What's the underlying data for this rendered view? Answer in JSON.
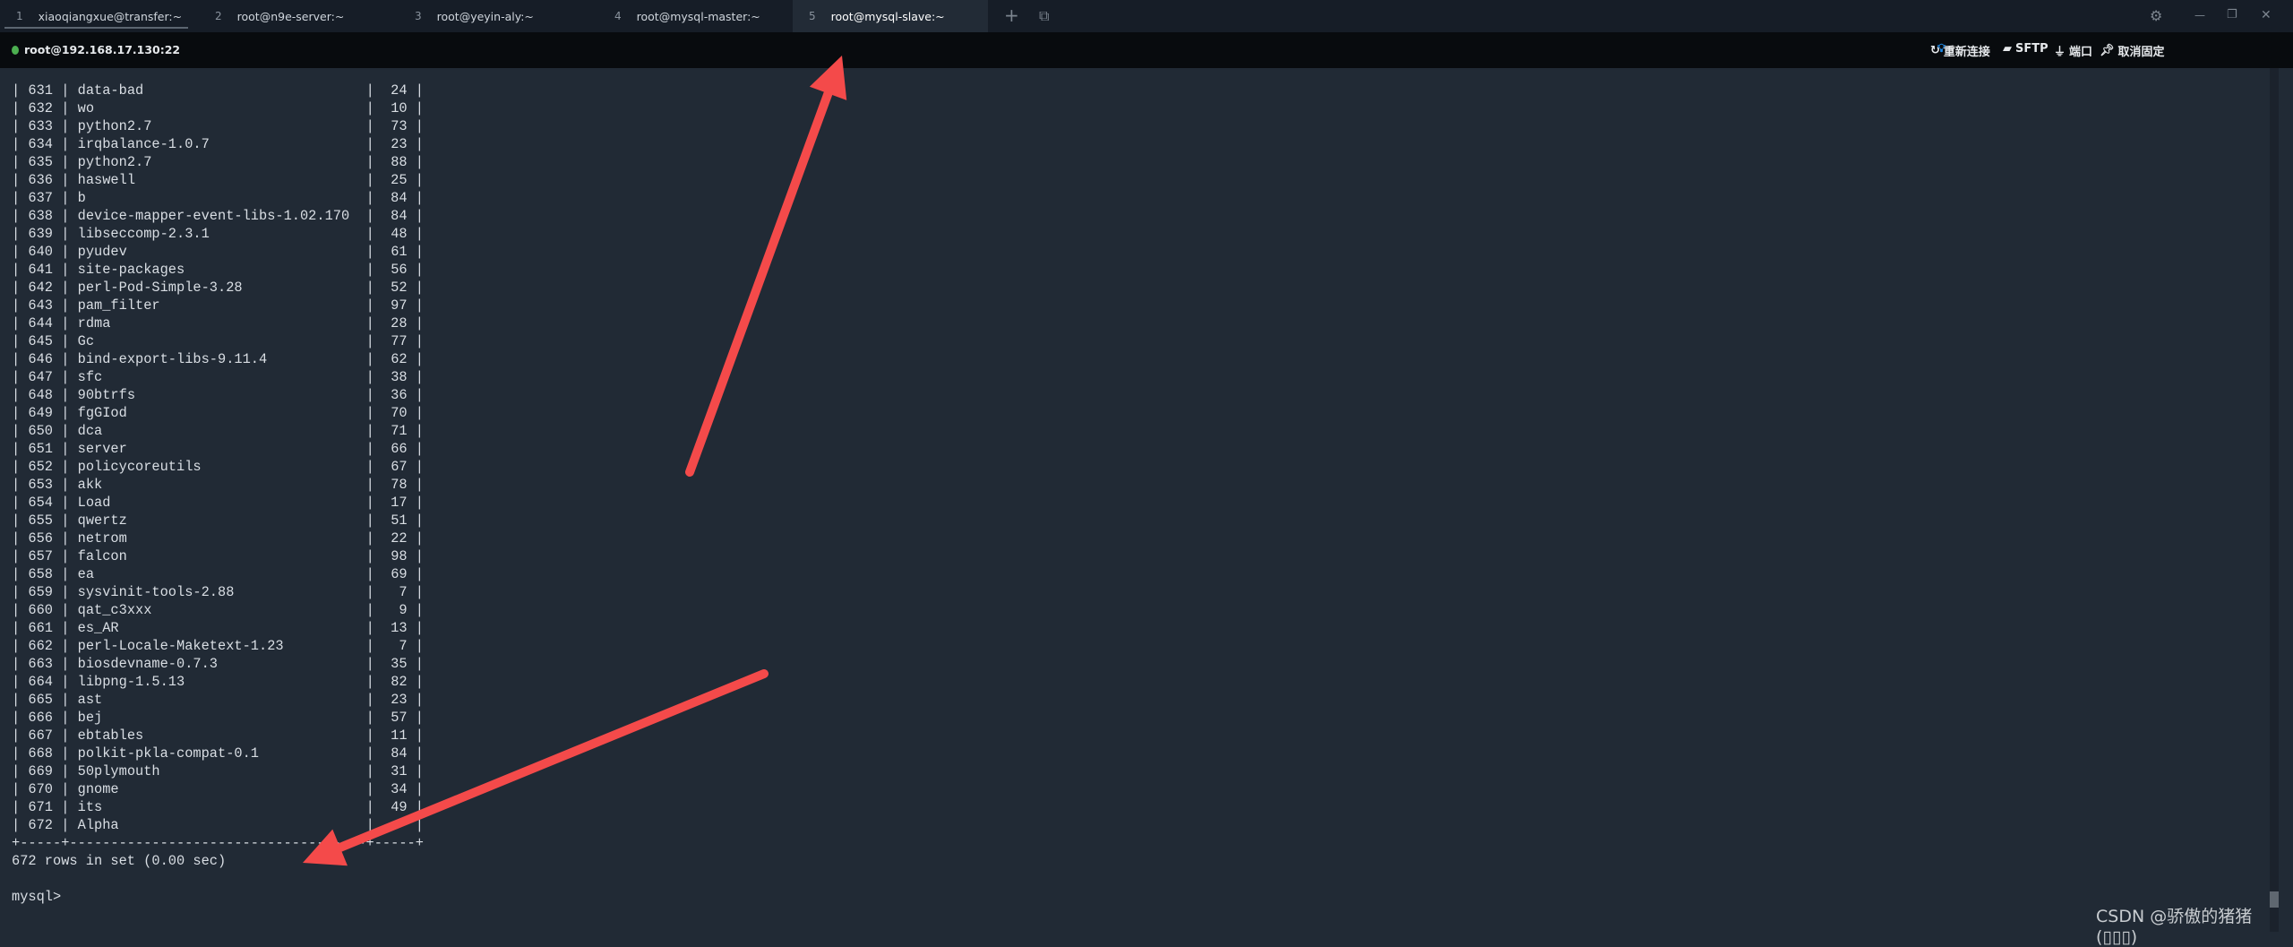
{
  "tabs": [
    {
      "num": "1",
      "label": "xiaoqiangxue@transfer:~"
    },
    {
      "num": "2",
      "label": "root@n9e-server:~"
    },
    {
      "num": "3",
      "label": "root@yeyin-aly:~"
    },
    {
      "num": "4",
      "label": "root@mysql-master:~"
    },
    {
      "num": "5",
      "label": "root@mysql-slave:~",
      "active": true
    }
  ],
  "tab_actions": {
    "add": "+",
    "duplicate": "⧉"
  },
  "window": {
    "settings": "⚙",
    "minimize": "—",
    "maximize": "❐",
    "close": "✕"
  },
  "toolbar": {
    "host": "root@192.168.17.130:22",
    "status_color": "#4caf50",
    "reconnect": "重新连接",
    "sftp": "SFTP",
    "port": "端口",
    "unpin": "取消固定"
  },
  "terminal": {
    "rows": [
      [
        "631",
        "data-bad",
        "24"
      ],
      [
        "632",
        "wo",
        "10"
      ],
      [
        "633",
        "python2.7",
        "73"
      ],
      [
        "634",
        "irqbalance-1.0.7",
        "23"
      ],
      [
        "635",
        "python2.7",
        "88"
      ],
      [
        "636",
        "haswell",
        "25"
      ],
      [
        "637",
        "b",
        "84"
      ],
      [
        "638",
        "device-mapper-event-libs-1.02.170",
        "84"
      ],
      [
        "639",
        "libseccomp-2.3.1",
        "48"
      ],
      [
        "640",
        "pyudev",
        "61"
      ],
      [
        "641",
        "site-packages",
        "56"
      ],
      [
        "642",
        "perl-Pod-Simple-3.28",
        "52"
      ],
      [
        "643",
        "pam_filter",
        "97"
      ],
      [
        "644",
        "rdma",
        "28"
      ],
      [
        "645",
        "Gc",
        "77"
      ],
      [
        "646",
        "bind-export-libs-9.11.4",
        "62"
      ],
      [
        "647",
        "sfc",
        "38"
      ],
      [
        "648",
        "90btrfs",
        "36"
      ],
      [
        "649",
        "fgGIod",
        "70"
      ],
      [
        "650",
        "dca",
        "71"
      ],
      [
        "651",
        "server",
        "66"
      ],
      [
        "652",
        "policycoreutils",
        "67"
      ],
      [
        "653",
        "akk",
        "78"
      ],
      [
        "654",
        "Load",
        "17"
      ],
      [
        "655",
        "qwertz",
        "51"
      ],
      [
        "656",
        "netrom",
        "22"
      ],
      [
        "657",
        "falcon",
        "98"
      ],
      [
        "658",
        "ea",
        "69"
      ],
      [
        "659",
        "sysvinit-tools-2.88",
        "7"
      ],
      [
        "660",
        "qat_c3xxx",
        "9"
      ],
      [
        "661",
        "es_AR",
        "13"
      ],
      [
        "662",
        "perl-Locale-Maketext-1.23",
        "7"
      ],
      [
        "663",
        "biosdevname-0.7.3",
        "35"
      ],
      [
        "664",
        "libpng-1.5.13",
        "82"
      ],
      [
        "665",
        "ast",
        "23"
      ],
      [
        "666",
        "bej",
        "57"
      ],
      [
        "667",
        "ebtables",
        "11"
      ],
      [
        "668",
        "polkit-pkla-compat-0.1",
        "84"
      ],
      [
        "669",
        "50plymouth",
        "31"
      ],
      [
        "670",
        "gnome",
        "34"
      ],
      [
        "671",
        "its",
        "49"
      ],
      [
        "672",
        "Alpha",
        ""
      ]
    ],
    "summary": "672 rows in set (0.00 sec)",
    "prompt": "mysql>"
  },
  "annotation_color": "#f44a4a",
  "watermark": "CSDN @骄傲的猪猪(▯▯▯)"
}
